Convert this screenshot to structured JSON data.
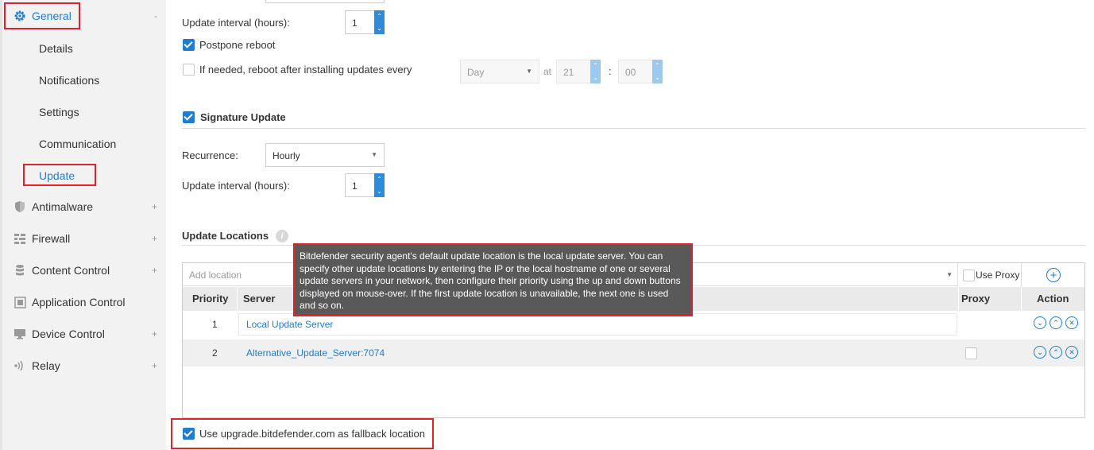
{
  "sidebar": {
    "general": {
      "label": "General",
      "toggle": "-"
    },
    "sub_items": {
      "details": "Details",
      "notifications": "Notifications",
      "settings": "Settings",
      "communication": "Communication",
      "update": "Update"
    },
    "antimalware": {
      "label": "Antimalware",
      "toggle": "+"
    },
    "firewall": {
      "label": "Firewall",
      "toggle": "+"
    },
    "content_control": {
      "label": "Content Control",
      "toggle": "+"
    },
    "application_control": {
      "label": "Application Control"
    },
    "device_control": {
      "label": "Device Control",
      "toggle": "+"
    },
    "relay": {
      "label": "Relay",
      "toggle": "+"
    }
  },
  "product_update": {
    "interval_label": "Update interval (hours):",
    "interval_value": "1",
    "postpone_reboot": "Postpone reboot",
    "reboot_label": "If needed, reboot after installing updates every",
    "reboot_day": "Day",
    "at_label": "at",
    "reboot_hour": "21",
    "colon": ":",
    "reboot_minute": "00"
  },
  "signature_update": {
    "title": "Signature Update",
    "recurrence_label": "Recurrence:",
    "recurrence_value": "Hourly",
    "interval_label": "Update interval (hours):",
    "interval_value": "1"
  },
  "update_locations": {
    "title": "Update Locations",
    "add_placeholder": "Add location",
    "use_proxy": "Use Proxy",
    "columns": {
      "priority": "Priority",
      "server": "Server",
      "proxy": "Proxy",
      "action": "Action"
    },
    "rows": [
      {
        "priority": "1",
        "server": "Local Update Server"
      },
      {
        "priority": "2",
        "server": "Alternative_Update_Server:7074"
      }
    ],
    "tooltip": "Bitdefender security agent's default update location is the local update server. You can specify other update locations by entering the IP or the local hostname of one or several update servers in your network, then configure their priority using the up and down buttons displayed on mouse-over. If the first update location is unavailable, the next one is used and so on."
  },
  "fallback": {
    "label": "Use upgrade.bitdefender.com as fallback location"
  },
  "colors": {
    "accent": "#1f7dd1",
    "highlight": "#e0222a"
  }
}
